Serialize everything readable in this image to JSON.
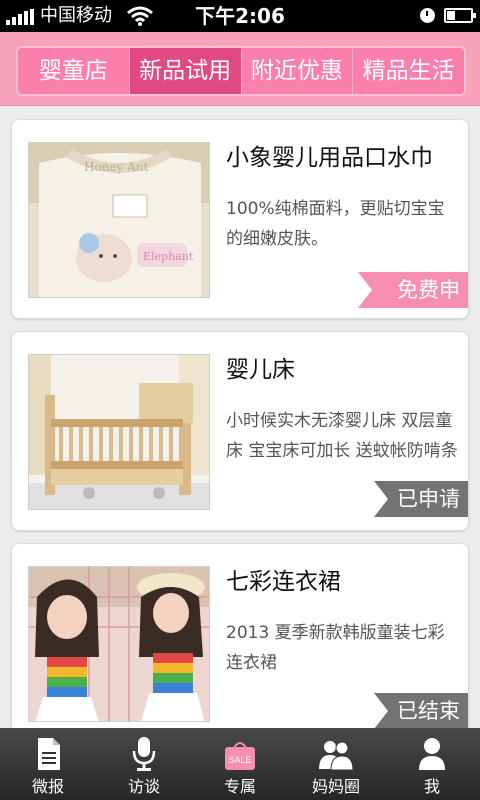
{
  "status_bar": {
    "carrier": "中国移动",
    "time": "下午2:06"
  },
  "tabs": [
    {
      "label": "婴童店",
      "active": false
    },
    {
      "label": "新品试用",
      "active": true
    },
    {
      "label": "附近优惠",
      "active": false
    },
    {
      "label": "精品生活",
      "active": false
    }
  ],
  "products": [
    {
      "title": "小象婴儿用品口水巾",
      "description": "100%纯棉面料，更贴切宝宝的细嫩皮肤。",
      "status": "免费申请",
      "image": "baby-bib-photo"
    },
    {
      "title": "婴儿床",
      "description": "小时候实木无漆婴儿床 双层童床 宝宝床可加长 送蚊帐防啃条",
      "status": "已申请",
      "image": "baby-crib-photo"
    },
    {
      "title": "七彩连衣裙",
      "description": "2013 夏季新款韩版童装七彩连衣裙",
      "status": "已结束",
      "image": "rainbow-dress-photo"
    }
  ],
  "bottom_nav": [
    {
      "label": "微报",
      "icon": "document-icon"
    },
    {
      "label": "访谈",
      "icon": "microphone-icon"
    },
    {
      "label": "专属",
      "icon": "sale-bag-icon",
      "badge": "SALE",
      "active": true
    },
    {
      "label": "妈妈圈",
      "icon": "group-icon"
    },
    {
      "label": "我",
      "icon": "person-icon"
    }
  ],
  "colors": {
    "header_pink": "#f7a2bb",
    "tab_bar_pink": "#fa7faa",
    "active_tab": "#e04a80",
    "ribbon_free": "#f58eb0",
    "ribbon_done": "#737373",
    "nav_background": "#262626"
  }
}
